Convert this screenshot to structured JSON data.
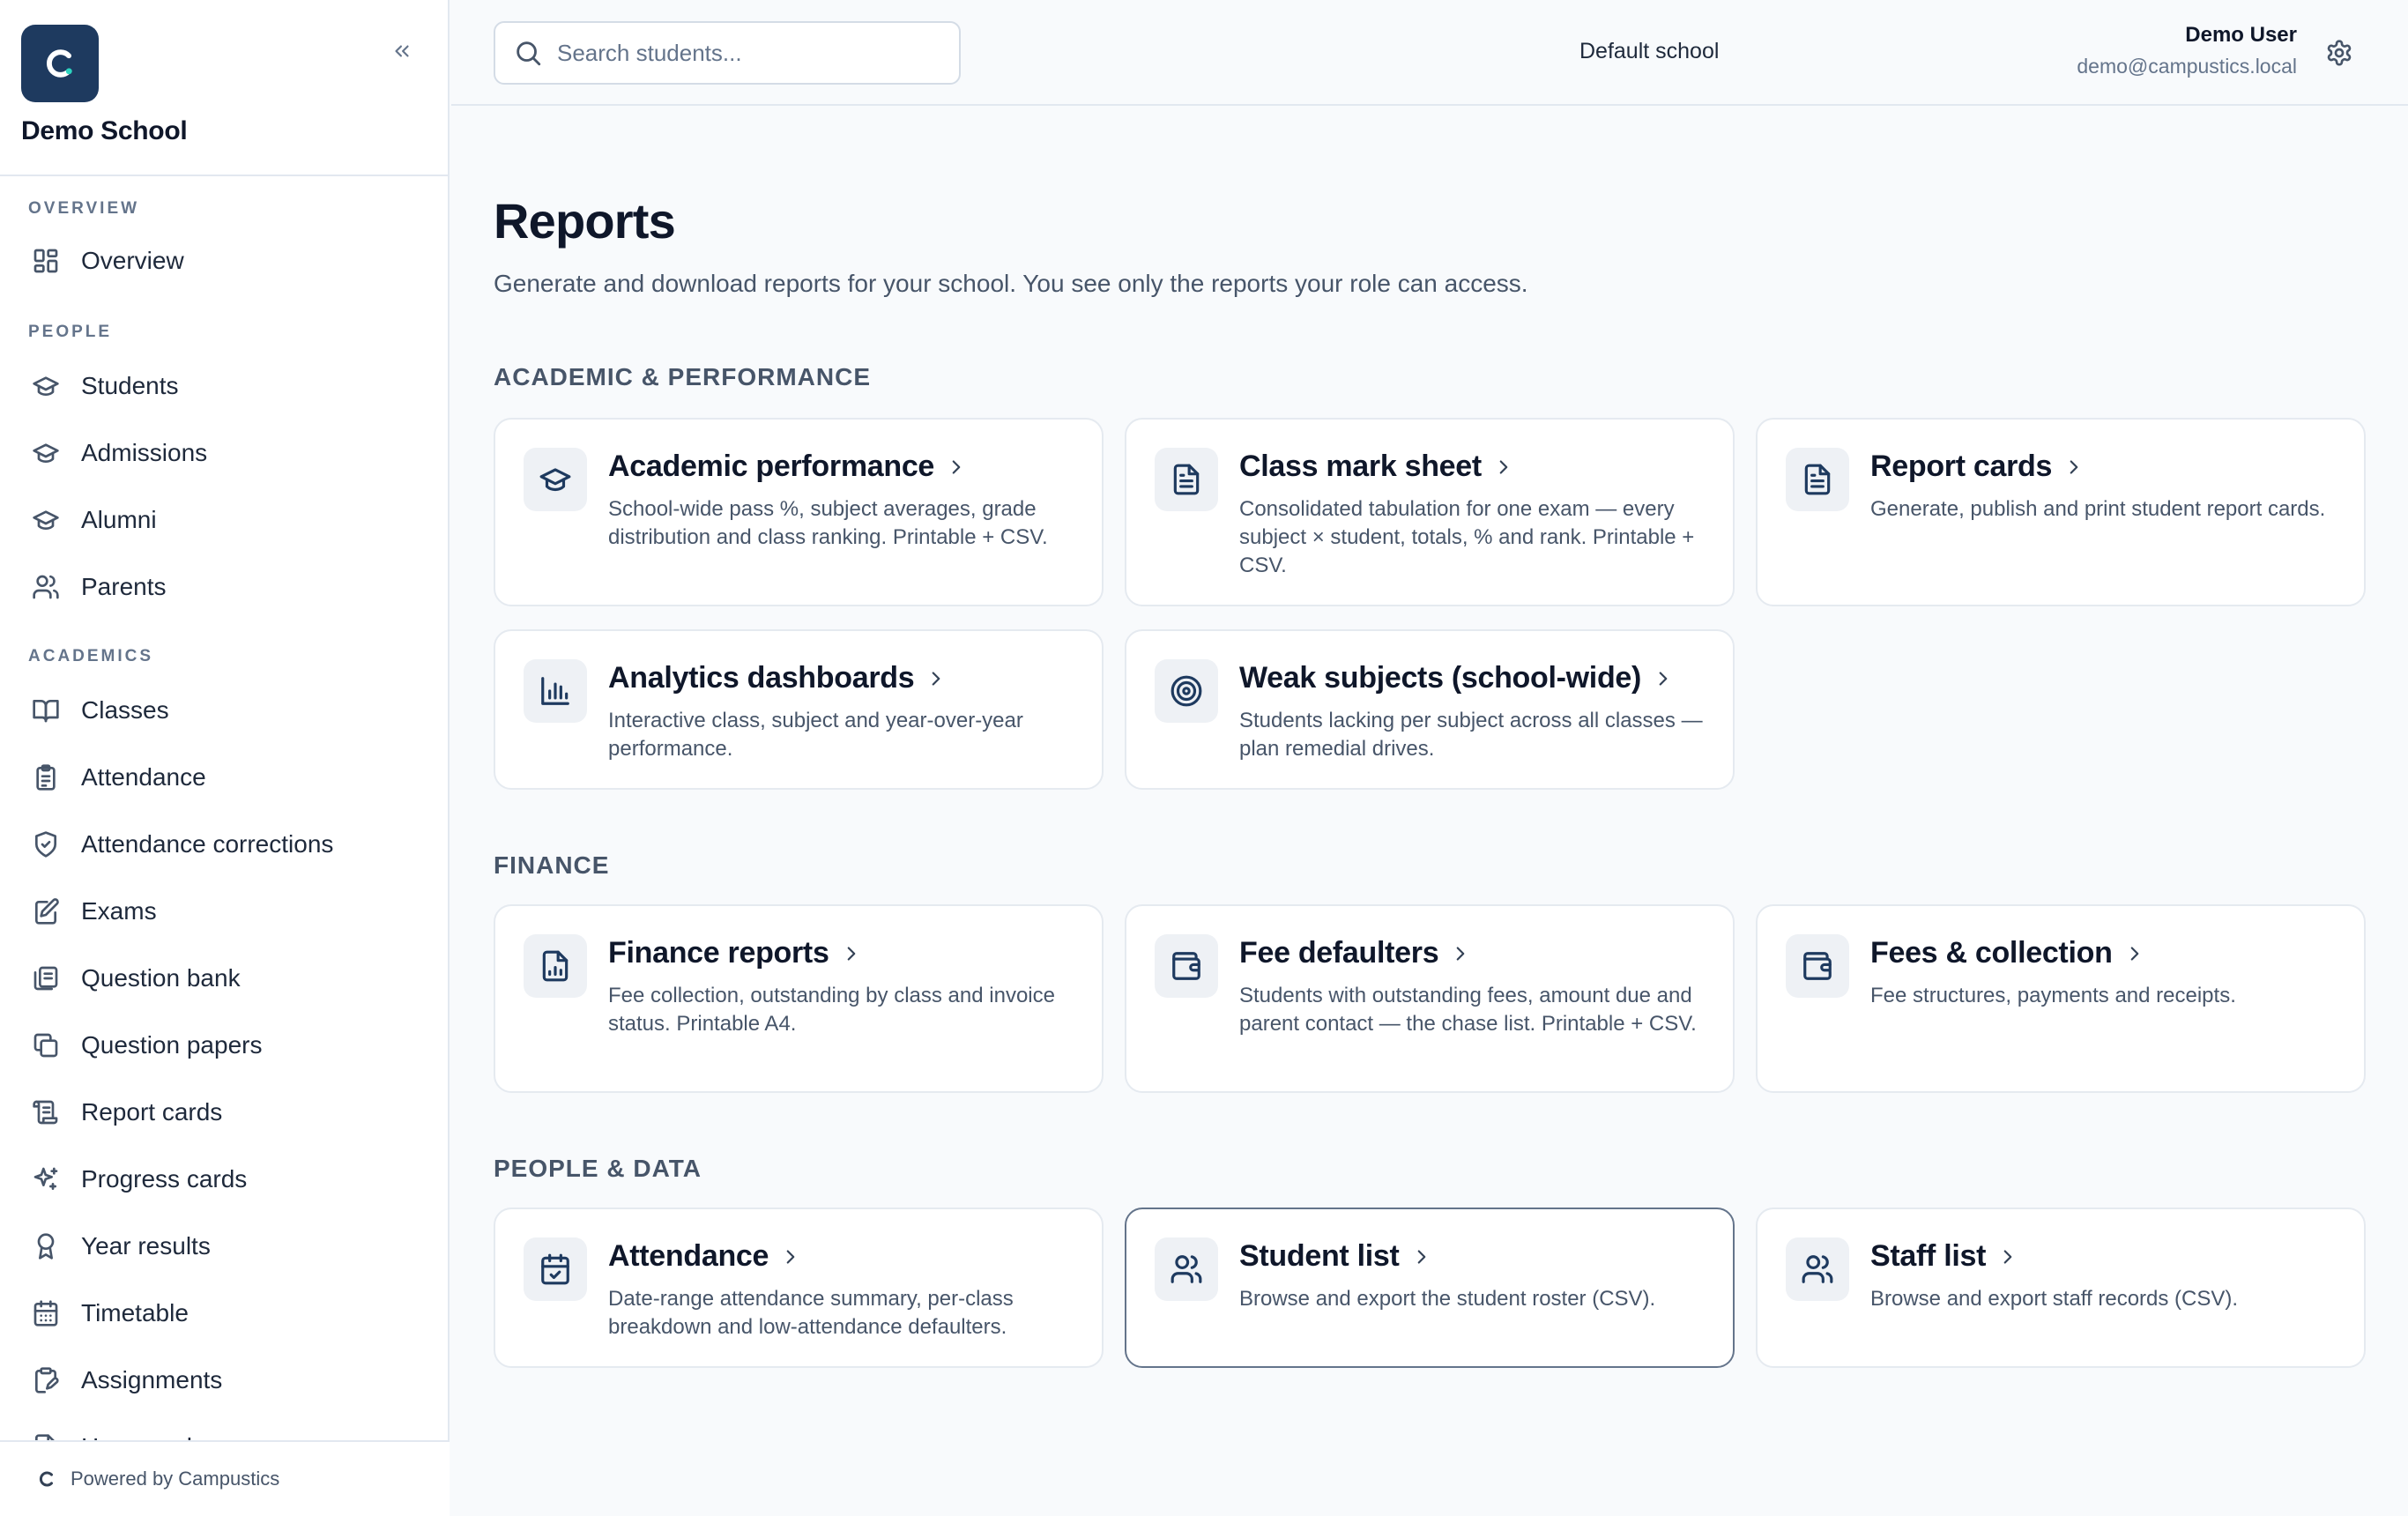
{
  "sidebar": {
    "brand_name": "Demo School",
    "groups": [
      {
        "label": "OVERVIEW",
        "items": [
          {
            "label": "Overview",
            "icon": "grid-icon"
          }
        ]
      },
      {
        "label": "PEOPLE",
        "items": [
          {
            "label": "Students",
            "icon": "graduation-cap-icon"
          },
          {
            "label": "Admissions",
            "icon": "graduation-cap-icon"
          },
          {
            "label": "Alumni",
            "icon": "graduation-cap-icon"
          },
          {
            "label": "Parents",
            "icon": "users-icon"
          }
        ]
      },
      {
        "label": "ACADEMICS",
        "items": [
          {
            "label": "Classes",
            "icon": "book-open-icon"
          },
          {
            "label": "Attendance",
            "icon": "clipboard-list-icon"
          },
          {
            "label": "Attendance corrections",
            "icon": "shield-check-icon"
          },
          {
            "label": "Exams",
            "icon": "file-edit-icon"
          },
          {
            "label": "Question bank",
            "icon": "library-icon"
          },
          {
            "label": "Question papers",
            "icon": "copy-icon"
          },
          {
            "label": "Report cards",
            "icon": "scroll-icon"
          },
          {
            "label": "Progress cards",
            "icon": "sparkles-icon"
          },
          {
            "label": "Year results",
            "icon": "award-icon"
          },
          {
            "label": "Timetable",
            "icon": "calendar-icon"
          },
          {
            "label": "Assignments",
            "icon": "clipboard-pen-icon"
          },
          {
            "label": "Homework",
            "icon": "file-pen-icon"
          }
        ]
      }
    ],
    "footer_text": "Powered by Campustics"
  },
  "header": {
    "search_placeholder": "Search students...",
    "school": "Default school",
    "user_name": "Demo User",
    "user_email": "demo@campustics.local"
  },
  "main": {
    "title": "Reports",
    "subtitle": "Generate and download reports for your school. You see only the reports your role can access.",
    "sections": [
      {
        "title": "ACADEMIC & PERFORMANCE",
        "cards": [
          {
            "title": "Academic performance",
            "icon": "graduation-cap-icon",
            "desc": "School-wide pass %, subject averages, grade distribution and class ranking. Printable + CSV."
          },
          {
            "title": "Class mark sheet",
            "icon": "file-text-icon",
            "desc": "Consolidated tabulation for one exam — every subject × student, totals, % and rank. Printable + CSV."
          },
          {
            "title": "Report cards",
            "icon": "file-text-icon",
            "desc": "Generate, publish and print student report cards."
          },
          {
            "title": "Analytics dashboards",
            "icon": "bar-chart-icon",
            "desc": "Interactive class, subject and year-over-year performance."
          },
          {
            "title": "Weak subjects (school-wide)",
            "icon": "target-icon",
            "desc": "Students lacking per subject across all classes — plan remedial drives."
          }
        ]
      },
      {
        "title": "FINANCE",
        "cards": [
          {
            "title": "Finance reports",
            "icon": "file-chart-icon",
            "desc": "Fee collection, outstanding by class and invoice status. Printable A4."
          },
          {
            "title": "Fee defaulters",
            "icon": "wallet-icon",
            "desc": "Students with outstanding fees, amount due and parent contact — the chase list. Printable + CSV."
          },
          {
            "title": "Fees & collection",
            "icon": "wallet-icon",
            "desc": "Fee structures, payments and receipts."
          }
        ]
      },
      {
        "title": "PEOPLE & DATA",
        "cards": [
          {
            "title": "Attendance",
            "icon": "calendar-check-icon",
            "desc": "Date-range attendance summary, per-class breakdown and low-attendance defaulters."
          },
          {
            "title": "Student list",
            "icon": "users-icon",
            "desc": "Browse and export the student roster (CSV)."
          },
          {
            "title": "Staff list",
            "icon": "users-icon",
            "desc": "Browse and export staff records (CSV)."
          }
        ]
      }
    ]
  },
  "colors": {
    "brand": "#1e3a5f",
    "background": "#f8fafc",
    "card_border": "#e5eaf0",
    "selected_border": "#64748b"
  }
}
